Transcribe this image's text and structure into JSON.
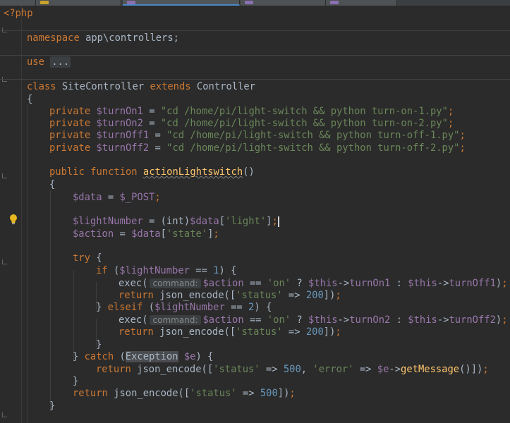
{
  "editor": {
    "tabs": [
      {
        "label": ""
      },
      {
        "label": ""
      },
      {
        "label": ""
      },
      {
        "label": ""
      }
    ],
    "icons": {
      "lightbulb": "lightbulb-icon"
    },
    "colors": {
      "background": "#2b2b2b",
      "keyword": "#cc7832",
      "variable": "#9876aa",
      "string": "#6a8759",
      "number": "#6897bb",
      "function": "#ffc66d",
      "text": "#a9b7c6"
    },
    "code": {
      "open_tag": "<?php",
      "namespace_kw": "namespace",
      "namespace_name": " app\\controllers;",
      "use_kw": "use",
      "use_folded": "...",
      "class_kw": "class",
      "class_name": " SiteController ",
      "extends_kw": "extends",
      "parent": " Controller",
      "brace_open": "{",
      "brace_close": "}",
      "private_kw": "private",
      "prop_turnOn1": "$turnOn1",
      "prop_turnOn2": "$turnOn2",
      "prop_turnOff1": "$turnOff1",
      "prop_turnOff2": "$turnOff2",
      "assign": " = ",
      "str_on1": "\"cd /home/pi/light-switch && python turn-on-1.py\"",
      "str_on2": "\"cd /home/pi/light-switch && python turn-on-2.py\"",
      "str_off1": "\"cd /home/pi/light-switch && python turn-off-1.py\"",
      "str_off2": "\"cd /home/pi/light-switch && python turn-off-2.py\"",
      "semi": ";",
      "public_kw": "public",
      "function_kw": "function",
      "method_name": "actionLightswitch",
      "parens": "()",
      "var_data": "$data",
      "var_post": "$_POST",
      "var_lightNumber": "$lightNumber",
      "cast_int": "(int)",
      "str_light": "'light'",
      "var_action": "$action",
      "str_state": "'state'",
      "try_kw": "try",
      "if_kw": "if",
      "elseif_kw": "elseif",
      "num_1": "1",
      "num_2": "2",
      "exec_fn": "exec(",
      "param_hint": "command:",
      "str_on": "'on'",
      "var_this": "$this",
      "arrow": "->",
      "member_turnOn1": "turnOn1",
      "member_turnOff1": "turnOff1",
      "member_turnOn2": "turnOn2",
      "member_turnOff2": "turnOff2",
      "return_kw": "return",
      "json_fn": "json_encode",
      "str_status": "'status'",
      "num_200": "200",
      "num_500": "500",
      "catch_kw": "catch",
      "exception_class": "Exception",
      "var_e": "$e",
      "str_error": "'error'",
      "getmessage_fn": "getMessage"
    }
  }
}
